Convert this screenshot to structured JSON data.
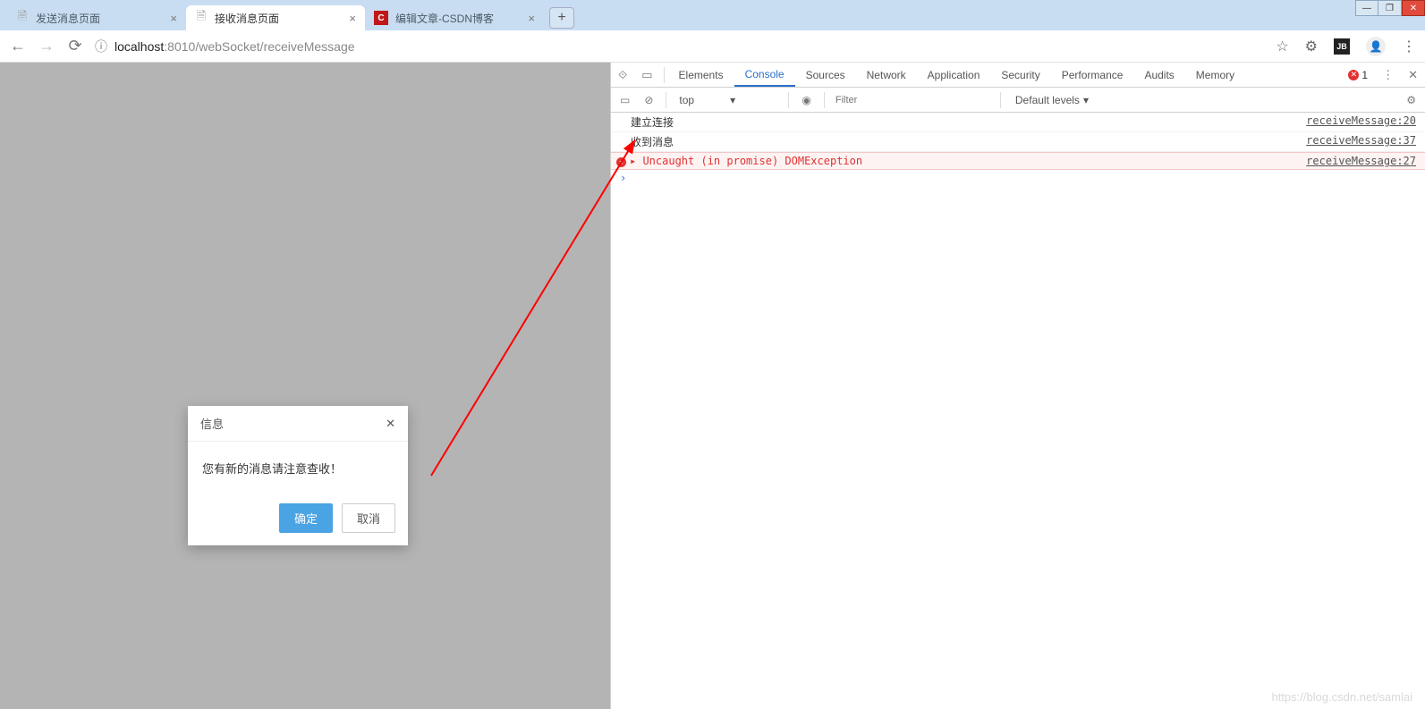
{
  "window": {
    "minimize": "—",
    "maximize": "❐",
    "close": "✕"
  },
  "tabs": [
    {
      "title": "发送消息页面",
      "icon": "page"
    },
    {
      "title": "接收消息页面",
      "icon": "page",
      "active": true
    },
    {
      "title": "编辑文章-CSDN博客",
      "icon": "csdn"
    }
  ],
  "newTab": "+",
  "nav": {
    "back": "←",
    "forward": "→",
    "reload": "⟳"
  },
  "address": {
    "info": "ⓘ",
    "scheme": "localhost",
    "port": ":8010",
    "path": "/webSocket/receiveMessage"
  },
  "addrRight": {
    "star": "☆",
    "bug": "⚙",
    "ext": "JB",
    "user": "👤",
    "more": "⋮"
  },
  "modal": {
    "title": "信息",
    "close": "✕",
    "body": "您有新的消息请注意查收！",
    "ok": "确定",
    "cancel": "取消"
  },
  "devtools": {
    "icons": {
      "inspect": "⟐",
      "device": "▭"
    },
    "tabs": [
      "Elements",
      "Console",
      "Sources",
      "Network",
      "Application",
      "Security",
      "Performance",
      "Audits",
      "Memory"
    ],
    "activeTab": "Console",
    "errorBadge": "1",
    "more": "⋮",
    "settings": "✕",
    "toolbar": {
      "play": "▭",
      "clear": "⊘",
      "context": "top",
      "caret": "▾",
      "eye": "◉",
      "filterPlaceholder": "Filter",
      "levels": "Default levels",
      "gear": "⚙"
    },
    "logs": [
      {
        "type": "normal",
        "msg": "建立连接",
        "src": "receiveMessage:20"
      },
      {
        "type": "normal",
        "msg": "收到消息",
        "src": "receiveMessage:37"
      },
      {
        "type": "error",
        "msg": "Uncaught (in promise) DOMException",
        "src": "receiveMessage:27"
      }
    ],
    "prompt": "›"
  },
  "watermark": "https://blog.csdn.net/samlai"
}
